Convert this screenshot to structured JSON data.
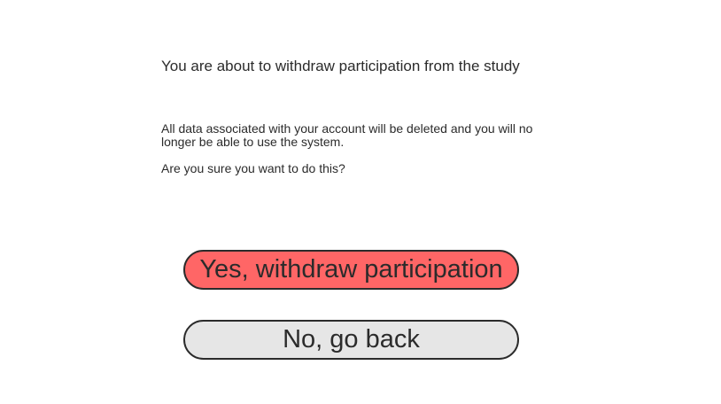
{
  "dialog": {
    "heading": "You are about to withdraw participation from the study",
    "message": "All data associated with your account will be deleted and you will no longer be able to use the system.",
    "question": "Are you sure you want to do this?",
    "confirm_label": "Yes, withdraw participation",
    "cancel_label": "No, go back"
  },
  "colors": {
    "confirm_bg": "#ff6666",
    "cancel_bg": "#e6e6e6",
    "text": "#2b2b2b"
  }
}
